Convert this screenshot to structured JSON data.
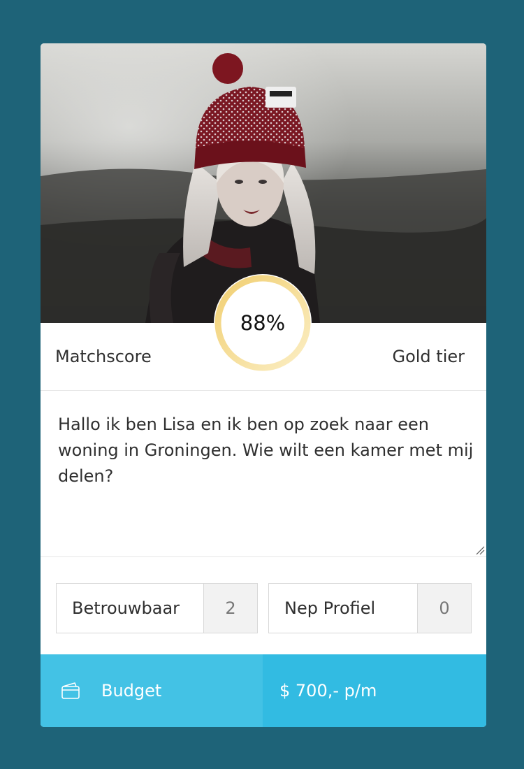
{
  "profile": {
    "photo": "profile-photo-woman-red-beanie",
    "match_score": "88%",
    "match_score_fraction": 0.88,
    "match_score_label": "Matchscore",
    "tier": "Gold tier",
    "message": "Hallo ik ben Lisa en ik ben op zoek naar een woning in Groningen. Wie wilt een kamer met mij delen?"
  },
  "votes": [
    {
      "label": "Betrouwbaar",
      "count": "2"
    },
    {
      "label": "Nep Profiel",
      "count": "0"
    }
  ],
  "budget": {
    "icon": "wallet-icon",
    "label": "Budget",
    "value": "$ 700,- p/m"
  },
  "colors": {
    "background": "#1e6378",
    "accent": "#32bbe2",
    "gold": "#f3d47f"
  }
}
